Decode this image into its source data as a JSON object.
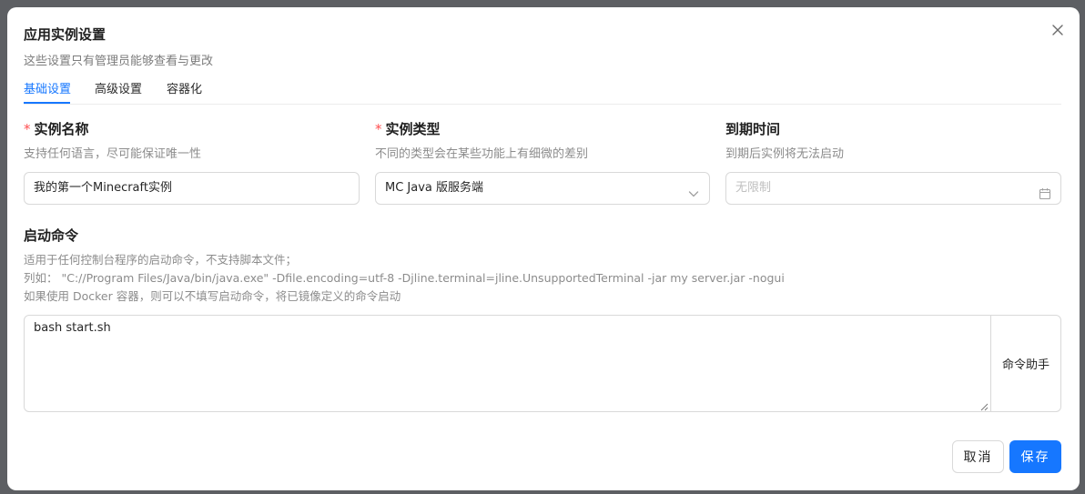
{
  "dialog": {
    "title": "应用实例设置",
    "subtitle": "这些设置只有管理员能够查看与更改"
  },
  "tabs": [
    {
      "label": "基础设置",
      "active": true
    },
    {
      "label": "高级设置",
      "active": false
    },
    {
      "label": "容器化",
      "active": false
    }
  ],
  "fields": {
    "name": {
      "required_mark": "*",
      "label": "实例名称",
      "help": "支持任何语言，尽可能保证唯一性",
      "value": "我的第一个Minecraft实例"
    },
    "type": {
      "required_mark": "*",
      "label": "实例类型",
      "help": "不同的类型会在某些功能上有细微的差别",
      "value": "MC Java 版服务端",
      "icon": "chevron-down-icon"
    },
    "expire": {
      "label": "到期时间",
      "help": "到期后实例将无法启动",
      "placeholder": "无限制",
      "icon": "calendar-icon"
    }
  },
  "command": {
    "label": "启动命令",
    "help_lines": [
      "适用于任何控制台程序的启动命令，不支持脚本文件；",
      "列如：  \"C://Program Files/Java/bin/java.exe\" -Dfile.encoding=utf-8 -Djline.terminal=jline.UnsupportedTerminal -jar my server.jar -nogui",
      "如果使用 Docker 容器，则可以不填写启动命令，将已镜像定义的命令启动"
    ],
    "value": "bash start.sh",
    "helper_button": "命令助手"
  },
  "footer": {
    "cancel": "取消",
    "save": "保存"
  },
  "colors": {
    "accent": "#1677ff",
    "required": "#ff4d4f",
    "overlay": "#5d5f63"
  }
}
